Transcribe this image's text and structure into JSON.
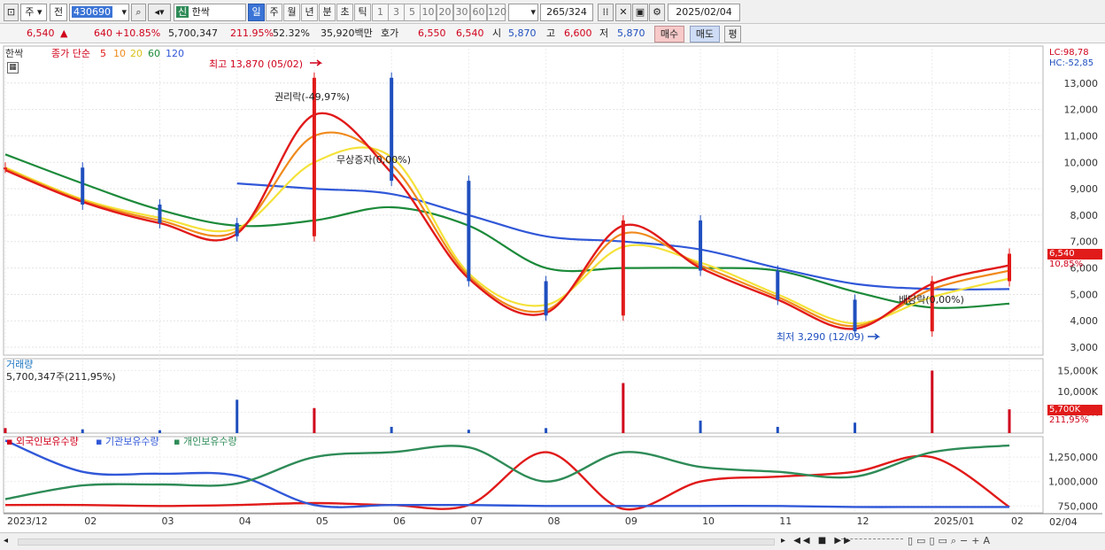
{
  "toolbar": {
    "market": "주",
    "scope": "전",
    "code": "430690",
    "badge": "신",
    "name": "한싹",
    "timeframes": [
      "일",
      "주",
      "월",
      "년",
      "분",
      "초",
      "틱"
    ],
    "active_timeframe": "일",
    "intervals": [
      "1",
      "3",
      "5",
      "10",
      "20",
      "30",
      "60",
      "120"
    ],
    "count_value": "265",
    "count_total": "/324",
    "date": "2025/02/04"
  },
  "quote": {
    "price": "6,540",
    "change": "640",
    "change_pct": "+10.85%",
    "volume": "5,700,347",
    "volume_ratio": "211.95%",
    "rate": "52.32%",
    "amount": "35,920백만",
    "ask_label": "호가",
    "ask1": "6,550",
    "ask2": "6,540",
    "open_label": "시",
    "open": "5,870",
    "high_label": "고",
    "high": "6,600",
    "low_label": "저",
    "low": "5,870",
    "buy": "매수",
    "sell": "매도",
    "eval": "평"
  },
  "price_panel": {
    "name": "한싹",
    "legend_prefix": "종가 단순",
    "ma_periods": [
      "5",
      "10",
      "20",
      "60",
      "120"
    ],
    "ma_colors": [
      "#e11a1a",
      "#f08a1c",
      "#f4e23a",
      "#1c8a3a",
      "#3158d8"
    ],
    "lc": "LC:98,78",
    "hc": "HC:-52,85",
    "high_note": "최고 13,870 (05/02)",
    "low_note": "최저 3,290 (12/09)",
    "rights_note": "권리락(-49,97%)",
    "bonus_note": "무상증자(0,00%)",
    "dividend_note": "배당락(0,00%)",
    "last_price_tag": "6,540",
    "last_pct_tag": "10,85%",
    "y_ticks": [
      "13,000",
      "12,000",
      "11,000",
      "10,000",
      "9,000",
      "8,000",
      "7,000",
      "6,000",
      "5,000",
      "4,000",
      "3,000"
    ]
  },
  "volume_panel": {
    "title": "거래량",
    "info": "5,700,347주(211,95%)",
    "y_ticks": [
      "15,000K",
      "10,000K",
      "5,000K"
    ],
    "tag_value": "5,700K",
    "tag_pct": "211,95%"
  },
  "holding_panel": {
    "series": [
      "외국인보유수량",
      "기관보유수량",
      "개인보유수량"
    ],
    "y_ticks": [
      "1,250,000",
      "1,000,000",
      "750,000"
    ]
  },
  "x_axis": [
    "2023/12",
    "02",
    "03",
    "04",
    "05",
    "06",
    "07",
    "08",
    "09",
    "10",
    "11",
    "12",
    "2025/01",
    "02"
  ],
  "x_axis_right": "02/04",
  "chart_data": {
    "type": "line",
    "title": "한싹",
    "x": [
      "2023/12",
      "02",
      "03",
      "04",
      "05",
      "06",
      "07",
      "08",
      "09",
      "10",
      "11",
      "12",
      "2025/01",
      "02"
    ],
    "series": [
      {
        "name": "종가",
        "values": [
          9800,
          8400,
          7700,
          7200,
          13200,
          9300,
          5500,
          4200,
          7800,
          5900,
          4800,
          3600,
          5500,
          6540
        ]
      },
      {
        "name": "5",
        "values": [
          9700,
          8500,
          7700,
          7300,
          11800,
          9600,
          5600,
          4300,
          7600,
          6000,
          4800,
          3700,
          5400,
          6100
        ]
      },
      {
        "name": "10",
        "values": [
          9750,
          8550,
          7800,
          7400,
          11000,
          9900,
          5700,
          4400,
          7300,
          6100,
          4900,
          3800,
          5200,
          5900
        ]
      },
      {
        "name": "20",
        "values": [
          9800,
          8600,
          7900,
          7500,
          10000,
          10200,
          5800,
          4600,
          6800,
          6200,
          5000,
          3900,
          4900,
          5600
        ]
      },
      {
        "name": "60",
        "values": [
          10300,
          9200,
          8200,
          7600,
          7800,
          8300,
          7600,
          6000,
          6000,
          6000,
          5900,
          5100,
          4500,
          4650
        ]
      },
      {
        "name": "120",
        "values": [
          null,
          null,
          null,
          9200,
          9000,
          8800,
          8000,
          7200,
          7000,
          6700,
          6000,
          5400,
          5200,
          5200
        ]
      }
    ],
    "ylim": [
      2700,
      14300
    ],
    "volume_k": [
      1200,
      900,
      700,
      8000,
      6000,
      1500,
      800,
      1200,
      12000,
      3000,
      1500,
      2500,
      15000,
      5700
    ],
    "holdings": [
      {
        "name": "외국인보유수량",
        "values": [
          760000,
          760000,
          750000,
          760000,
          780000,
          760000,
          760000,
          1300000,
          720000,
          1000000,
          1050000,
          1100000,
          1250000,
          740000
        ]
      },
      {
        "name": "기관보유수량",
        "values": [
          1420000,
          1100000,
          1080000,
          1060000,
          760000,
          760000,
          760000,
          750000,
          750000,
          750000,
          750000,
          740000,
          740000,
          740000
        ]
      },
      {
        "name": "개인보유수량",
        "values": [
          820000,
          960000,
          970000,
          980000,
          1250000,
          1300000,
          1350000,
          1000000,
          1300000,
          1150000,
          1100000,
          1050000,
          1300000,
          1370000
        ]
      }
    ],
    "holdings_ylim": [
      680000,
      1460000
    ]
  }
}
